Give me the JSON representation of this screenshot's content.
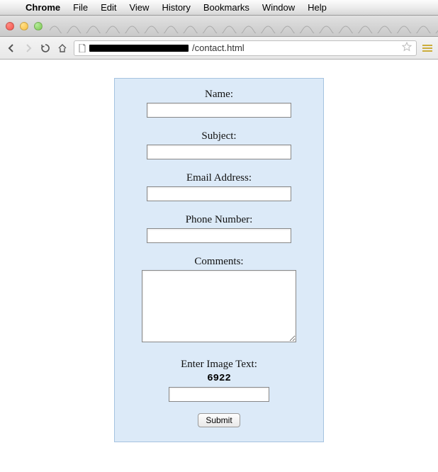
{
  "menubar": {
    "app": "Chrome",
    "items": [
      "File",
      "Edit",
      "View",
      "History",
      "Bookmarks",
      "Window",
      "Help"
    ]
  },
  "toolbar": {
    "url_visible_part": "/contact.html"
  },
  "form": {
    "name_label": "Name:",
    "subject_label": "Subject:",
    "email_label": "Email Address:",
    "phone_label": "Phone Number:",
    "comments_label": "Comments:",
    "captcha_label": "Enter Image Text:",
    "captcha_value": "6922",
    "submit_label": "Submit"
  }
}
